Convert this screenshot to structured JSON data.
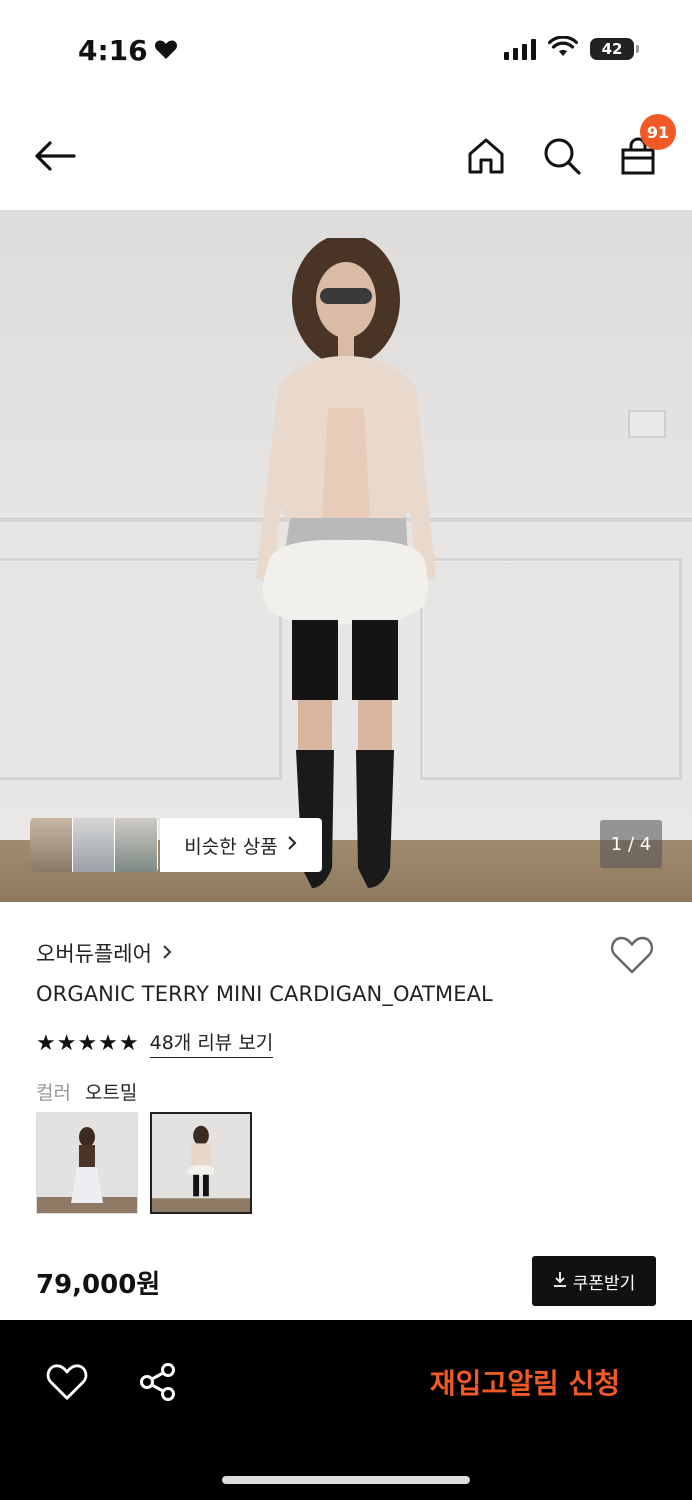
{
  "status_bar": {
    "time": "4:16",
    "battery": "42"
  },
  "header": {
    "cart_count": "91"
  },
  "hero": {
    "similar_label": "비슷한 상품",
    "page_indicator": "1 / 4"
  },
  "product": {
    "brand": "오버듀플레어",
    "name": "ORGANIC TERRY MINI CARDIGAN_OATMEAL",
    "stars": "★★★★★",
    "review_link": "48개 리뷰 보기",
    "color_key": "컬러",
    "color_value": "오트밀",
    "price": "79,000원",
    "coupon_label": "쿠폰받기"
  },
  "bottom_bar": {
    "restock_label": "재입고알림 신청"
  },
  "colors": {
    "accent": "#f15a24",
    "dark": "#111111"
  }
}
